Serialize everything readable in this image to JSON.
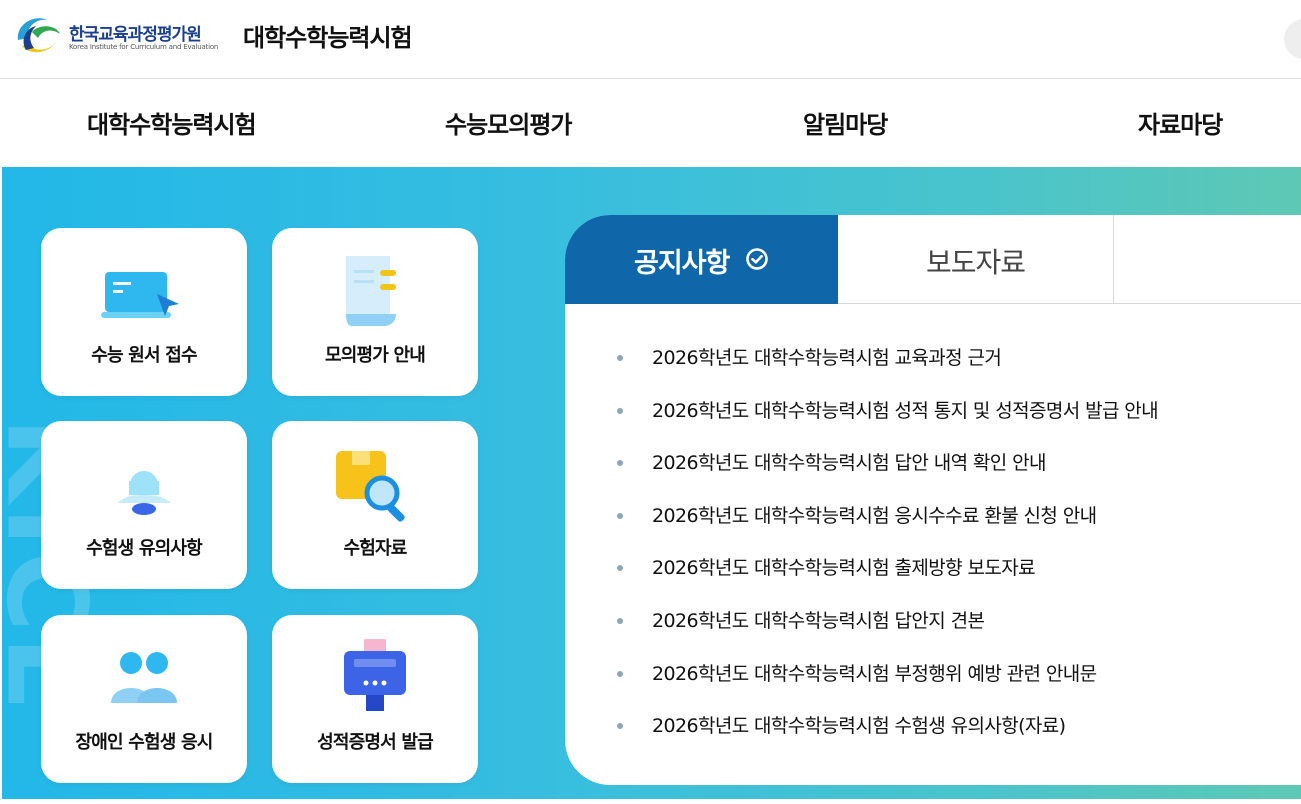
{
  "header": {
    "org_name_ko": "한국교육과정평가원",
    "org_name_en": "Korea Institute for Curriculum and Evaluation",
    "site_title": "대학수학능력시험"
  },
  "gnb": {
    "items": [
      {
        "label": "대학수학능력시험"
      },
      {
        "label": "수능모의평가"
      },
      {
        "label": "알림마당"
      },
      {
        "label": "자료마당"
      }
    ]
  },
  "hero": {
    "background_text": "KICE"
  },
  "quick_links": [
    {
      "label": "수능 원서 접수",
      "icon": "laptop-icon"
    },
    {
      "label": "모의평가 안내",
      "icon": "document-icon"
    },
    {
      "label": "수험생 유의사항",
      "icon": "bell-icon"
    },
    {
      "label": "수험자료",
      "icon": "box-search-icon"
    },
    {
      "label": "장애인 수험생 응시",
      "icon": "people-icon"
    },
    {
      "label": "성적증명서 발급",
      "icon": "kiosk-icon"
    }
  ],
  "notice_panel": {
    "tabs": [
      {
        "label": "공지사항",
        "active": true
      },
      {
        "label": "보도자료",
        "active": false
      }
    ],
    "items": [
      "2026학년도 대학수학능력시험 교육과정 근거",
      "2026학년도 대학수학능력시험 성적 통지 및 성적증명서 발급 안내",
      "2026학년도 대학수학능력시험 답안 내역 확인 안내",
      "2026학년도 대학수학능력시험 응시수수료 환불 신청 안내",
      "2026학년도 대학수학능력시험 출제방향 보도자료",
      "2026학년도 대학수학능력시험 답안지 견본",
      "2026학년도 대학수학능력시험 부정행위 예방 관련 안내문",
      "2026학년도 대학수학능력시험 수험생 유의사항(자료)"
    ]
  },
  "colors": {
    "brand_navy": "#1b3f8f",
    "tab_active": "#0f66a9",
    "hero_start": "#22b8e8",
    "hero_end": "#5ec8b4"
  }
}
